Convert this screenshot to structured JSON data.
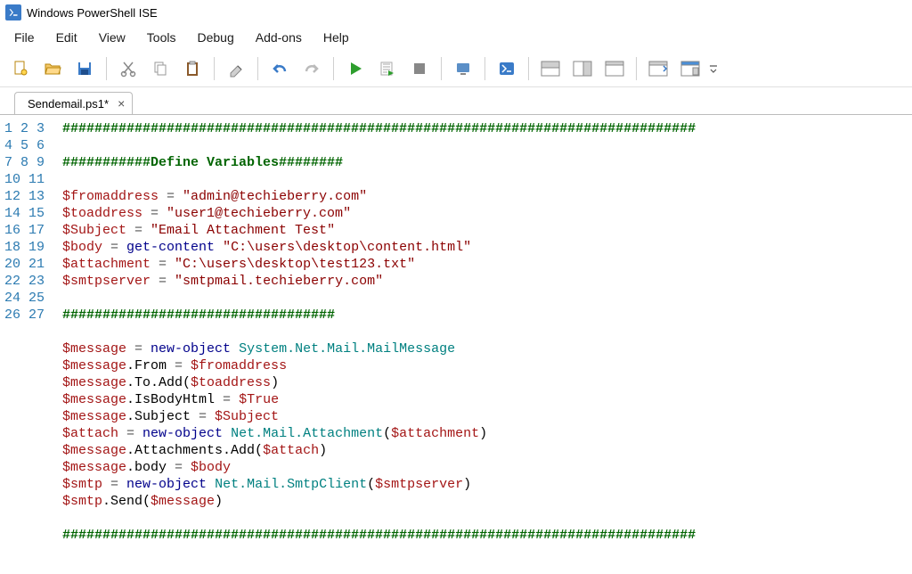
{
  "window": {
    "title": "Windows PowerShell ISE"
  },
  "menu": {
    "file": "File",
    "edit": "Edit",
    "view": "View",
    "tools": "Tools",
    "debug": "Debug",
    "addons": "Add-ons",
    "help": "Help"
  },
  "toolbar_icons": {
    "new": "new-file-icon",
    "open": "open-folder-icon",
    "save": "save-icon",
    "cut": "cut-icon",
    "copy": "copy-icon",
    "paste": "paste-icon",
    "clear": "clear-icon",
    "undo": "undo-icon",
    "redo": "redo-icon",
    "run": "run-script-icon",
    "run_sel": "run-selection-icon",
    "stop": "stop-icon",
    "remote": "remote-icon",
    "ps": "powershell-icon",
    "panes1": "pane-layout-1-icon",
    "panes2": "pane-layout-2-icon",
    "panes3": "pane-layout-3-icon",
    "script1": "script-pane-1-icon",
    "script2": "script-pane-2-icon",
    "overflow": "toolbar-overflow-icon"
  },
  "tabs": [
    {
      "label": "Sendemail.ps1*",
      "close": "×"
    }
  ],
  "code": {
    "l1": "###############################################################################",
    "l3": "###########Define Variables########",
    "l5": {
      "v": "$fromaddress",
      "s": "\"admin@techieberry.com\""
    },
    "l6": {
      "v": "$toaddress",
      "s": "\"user1@techieberry.com\""
    },
    "l7": {
      "v": "$Subject",
      "s": "\"Email Attachment Test\""
    },
    "l8": {
      "v": "$body",
      "k": "get-content",
      "s": "\"C:\\users\\desktop\\content.html\""
    },
    "l9": {
      "v": "$attachment",
      "s": "\"C:\\users\\desktop\\test123.txt\""
    },
    "l10": {
      "v": "$smtpserver",
      "s": "\"smtpmail.techieberry.com\""
    },
    "l12": "##################################",
    "l14": {
      "v": "$message",
      "k": "new-object",
      "t": "System.Net.Mail.MailMessage"
    },
    "l15": {
      "v1": "$message",
      "m": ".From",
      "v2": "$fromaddress"
    },
    "l16": {
      "v1": "$message",
      "m1": ".To",
      "m2": ".Add(",
      "v2": "$toaddress",
      "m3": ")"
    },
    "l17": {
      "v1": "$message",
      "m": ".IsBodyHtml",
      "v2": "$True"
    },
    "l18": {
      "v1": "$message",
      "m": ".Subject",
      "v2": "$Subject"
    },
    "l19": {
      "v1": "$attach",
      "k": "new-object",
      "t": "Net.Mail.Attachment",
      "p1": "(",
      "v2": "$attachment",
      "p2": ")"
    },
    "l20": {
      "v1": "$message",
      "m1": ".Attachments",
      "m2": ".Add(",
      "v2": "$attach",
      "m3": ")"
    },
    "l21": {
      "v1": "$message",
      "m": ".body",
      "v2": "$body"
    },
    "l22": {
      "v1": "$smtp",
      "k": "new-object",
      "t": "Net.Mail.SmtpClient",
      "p1": "(",
      "v2": "$smtpserver",
      "p2": ")"
    },
    "l23": {
      "v1": "$smtp",
      "m1": ".Send(",
      "v2": "$message",
      "m2": ")"
    },
    "l25": "###############################################################################"
  }
}
